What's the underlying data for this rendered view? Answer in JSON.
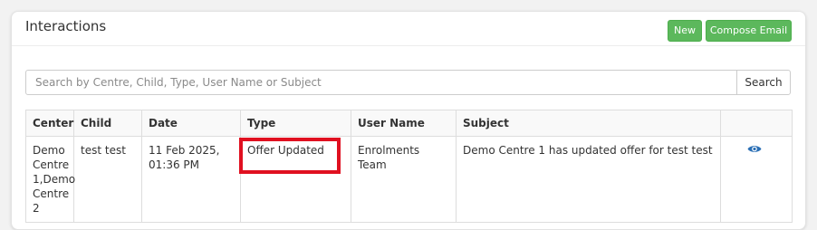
{
  "panel": {
    "title": "Interactions",
    "new_label": "New",
    "compose_label": "Compose Email"
  },
  "search": {
    "placeholder": "Search by Centre, Child, Type, User Name or Subject",
    "value": "",
    "button_label": "Search"
  },
  "table": {
    "headers": {
      "center": "Center",
      "child": "Child",
      "date": "Date",
      "type": "Type",
      "user_name": "User Name",
      "subject": "Subject"
    },
    "rows": [
      {
        "center": "Demo Centre 1,Demo Centre 2",
        "child": "test test",
        "date": "11 Feb 2025, 01:36 PM",
        "type": "Offer Updated",
        "user_name": "Enrolments Team",
        "subject": "Demo Centre 1 has updated offer for test test",
        "action_icon": "eye-icon"
      }
    ]
  },
  "colors": {
    "accent_green": "#5cb85c",
    "highlight_red": "#e01020",
    "eye_blue": "#2a6fb5"
  }
}
